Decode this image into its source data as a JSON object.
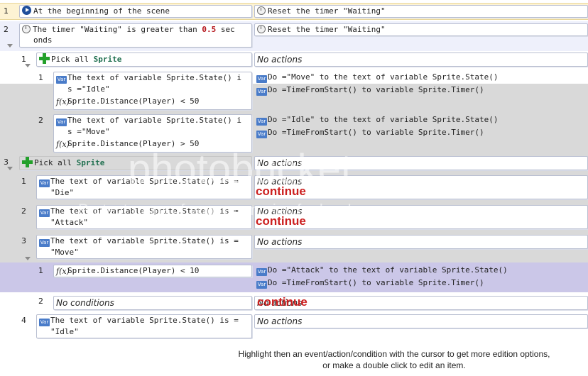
{
  "events": {
    "e1": {
      "num": "1",
      "condition": "At the beginning of the scene",
      "action": "Reset the timer \"Waiting\""
    },
    "e2": {
      "num": "2",
      "condition_l1": "The timer \"Waiting\" is greater than ",
      "condition_val": "0.5",
      "condition_l1b": " sec",
      "condition_l2": "onds",
      "action": "Reset the timer \"Waiting\"",
      "sub1": {
        "num": "1",
        "condition_pre": "Pick all ",
        "condition_obj": "Sprite",
        "actions": "No actions",
        "sub1": {
          "num": "1",
          "c1_l1": "The text of variable Sprite.State() i",
          "c1_l2": "s =\"Idle\"",
          "c2": "Sprite.Distance(Player) < 50",
          "a1": "Do =\"Move\" to the text of variable Sprite.State()",
          "a2": "Do =TimeFromStart() to variable Sprite.Timer()"
        },
        "sub2": {
          "num": "2",
          "c1_l1": "The text of variable Sprite.State() i",
          "c1_l2": "s =\"Move\"",
          "c2": "Sprite.Distance(Player) > 50",
          "a1": "Do =\"Idle\" to the text of variable Sprite.State()",
          "a2": "Do =TimeFromStart() to variable Sprite.Timer()"
        }
      }
    },
    "e3": {
      "num": "3",
      "condition_pre": "Pick all ",
      "condition_obj": "Sprite",
      "actions": "No actions",
      "sub1": {
        "num": "1",
        "c_l1": "The text of variable Sprite.State() is =",
        "c_l2": "\"Die\"",
        "actions": "No actions",
        "cont": "continue"
      },
      "sub2": {
        "num": "2",
        "c_l1": "The text of variable Sprite.State() is =",
        "c_l2": "\"Attack\"",
        "actions": "No actions",
        "cont": "continue"
      },
      "sub3": {
        "num": "3",
        "c_l1": "The text of variable Sprite.State() is =",
        "c_l2": "\"Move\"",
        "actions": "No actions",
        "sub1": {
          "num": "1",
          "c": "Sprite.Distance(Player) < 10",
          "a1": "Do =\"Attack\" to the text of variable Sprite.State()",
          "a2": "Do =TimeFromStart() to variable Sprite.Timer()"
        },
        "sub2": {
          "num": "2",
          "conditions": "No conditions",
          "actions": "No actions",
          "cont": "continue"
        }
      }
    },
    "e4": {
      "num": "4",
      "c_l1": "The text of variable Sprite.State() is =",
      "c_l2": "\"Idle\"",
      "actions": "No actions"
    }
  },
  "icons": {
    "var": "Var",
    "f": "f(x)"
  },
  "watermark": {
    "main": "photobucket",
    "sub": "Protect more of your memories for less!"
  },
  "footer": {
    "line1": "Highlight then an event/action/condition with the cursor to get more edition options,",
    "line2": "or make a double click to edit an item."
  },
  "colors": {
    "event_band": "#fdf3d3",
    "event_band2": "#eef0fb",
    "sub_band_gray": "#d9d9d9",
    "sub_band_purple": "#cbc7e8",
    "continue_red": "#cc1f1f"
  }
}
